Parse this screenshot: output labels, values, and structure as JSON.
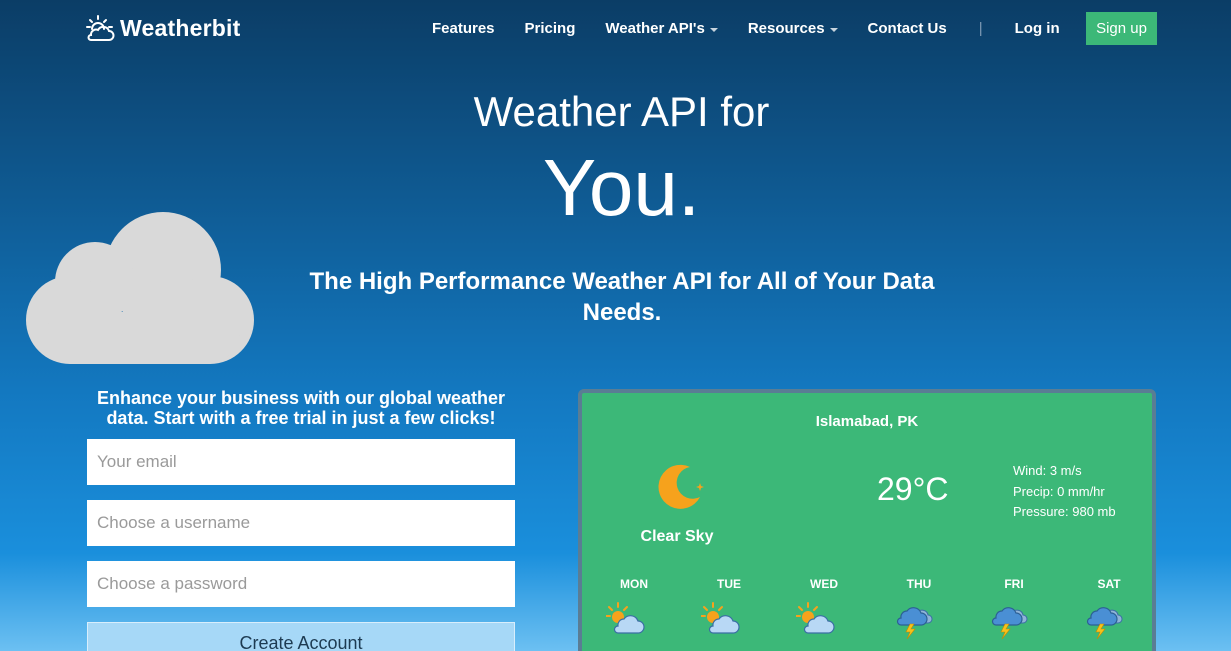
{
  "nav": {
    "logo_text": "Weatherbit",
    "links": [
      {
        "label": "Features",
        "dropdown": false
      },
      {
        "label": "Pricing",
        "dropdown": false
      },
      {
        "label": "Weather API's",
        "dropdown": true
      },
      {
        "label": "Resources",
        "dropdown": true
      },
      {
        "label": "Contact Us",
        "dropdown": false
      }
    ],
    "separator": "|",
    "login_label": "Log in",
    "signup_label": "Sign up"
  },
  "hero": {
    "line1": "Weather API for",
    "line2": "You.",
    "subtitle": "The High Performance Weather API for All of Your Data Needs."
  },
  "signup_form": {
    "intro": "Enhance your business with our global weather data. Start with a free trial in just a few clicks!",
    "email_placeholder": "Your email",
    "username_placeholder": "Choose a username",
    "password_placeholder": "Choose a password",
    "submit_label": "Create Account"
  },
  "widget": {
    "city": "Islamabad, PK",
    "icon": "moon-icon",
    "description": "Clear Sky",
    "temperature": "29°C",
    "wind": "Wind: 3 m/s",
    "precip": "Precip: 0 mm/hr",
    "pressure": "Pressure: 980 mb",
    "days": [
      {
        "label": "MON",
        "icon": "partly-cloudy-sun-icon"
      },
      {
        "label": "TUE",
        "icon": "partly-cloudy-sun-icon"
      },
      {
        "label": "WED",
        "icon": "partly-cloudy-sun-icon"
      },
      {
        "label": "THU",
        "icon": "thunderstorm-icon"
      },
      {
        "label": "FRI",
        "icon": "thunderstorm-icon"
      },
      {
        "label": "SAT",
        "icon": "thunderstorm-icon"
      }
    ]
  },
  "colors": {
    "accent_green": "#3cb878",
    "widget_border": "#5a7d94",
    "cloud_gray": "#d9d9d9",
    "button_light_blue": "#a6d8f7",
    "sun_orange": "#f6a21c"
  }
}
